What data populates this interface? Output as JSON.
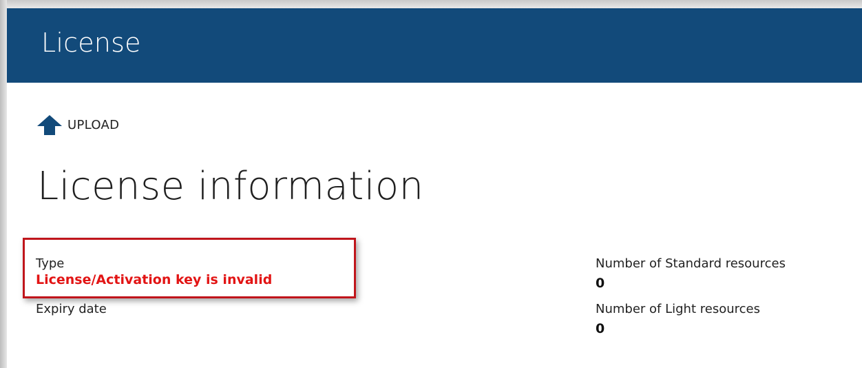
{
  "window": {
    "title": "License"
  },
  "toolbar": {
    "upload_label": "UPLOAD",
    "upload_icon": "upload-arrow-icon"
  },
  "page": {
    "heading": "License information"
  },
  "fields": {
    "type": {
      "label": "Type",
      "value": "License/Activation key is invalid"
    },
    "expiry": {
      "label": "Expiry date",
      "value": ""
    },
    "standard_resources": {
      "label": "Number of Standard resources",
      "value": "0"
    },
    "light_resources": {
      "label": "Number of Light resources",
      "value": "0"
    }
  },
  "colors": {
    "titlebar": "#124a7a",
    "error_text": "#e21414",
    "highlight_border": "#c0151b"
  }
}
